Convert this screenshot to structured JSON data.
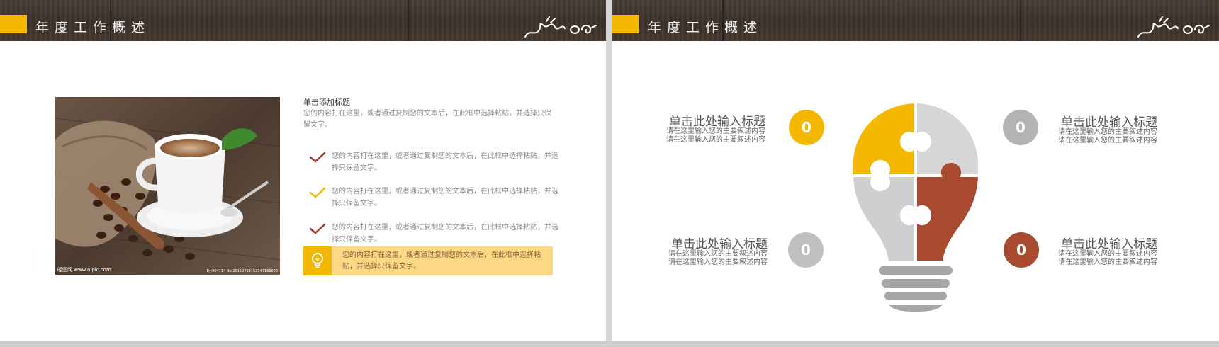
{
  "slides": [
    {
      "header_title": "年度工作概述",
      "photo": {
        "watermark": "昵图网 www.nipic.com",
        "watermark_id": "By:004114 No:20150413152147165000"
      },
      "heading": "单击添加标题",
      "paragraph": "您的内容打在这里，或者通过复制您的文本后，在此框中选择粘贴，并选择只保留文字。",
      "bullets": [
        {
          "text": "您的内容打在这里，或者通过复制您的文本后，在此框中选择粘贴，并选择只保留文字。",
          "color": "#9b3a2a"
        },
        {
          "text": "您的内容打在这里，或者通过复制您的文本后，在此框中选择粘贴，并选择只保留文字。",
          "color": "#f5b800"
        },
        {
          "text": "您的内容打在这里，或者通过复制您的文本后，在此框中选择粘贴，并选择只保留文字。",
          "color": "#9b3a2a"
        }
      ],
      "highlight": {
        "text": "您的内容打在这里，或者通过复制您的文本后，在此框中选择粘贴，并选择只保留文字。",
        "icon": "lightbulb-icon"
      }
    },
    {
      "header_title": "年度工作概述",
      "items": [
        {
          "title": "单击此处输入标题",
          "desc1": "请在这里输入您的主要叙述内容",
          "desc2": "请在这里输入您的主要叙述内容",
          "number": "0",
          "color": "#f5b800"
        },
        {
          "title": "单击此处输入标题",
          "desc1": "请在这里输入您的主要叙述内容",
          "desc2": "请在这里输入您的主要叙述内容",
          "number": "0",
          "color": "#b3b3b3"
        },
        {
          "title": "单击此处输入标题",
          "desc1": "请在这里输入您的主要叙述内容",
          "desc2": "请在这里输入您的主要叙述内容",
          "number": "0",
          "color": "#bfbfbf"
        },
        {
          "title": "单击此处输入标题",
          "desc1": "请在这里输入您的主要叙述内容",
          "desc2": "请在这里输入您的主要叙述内容",
          "number": "0",
          "color": "#a84a2f"
        }
      ],
      "bulb_colors": {
        "top_left": "#f5b800",
        "top_right": "#d6d6d6",
        "bottom_left": "#cfcfcf",
        "bottom_right": "#a84a2f",
        "base": "#a6a6a6"
      }
    }
  ],
  "colors": {
    "accent": "#f5b800",
    "brown": "#9b3a2a",
    "header": "#3f352c"
  }
}
